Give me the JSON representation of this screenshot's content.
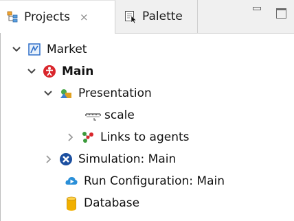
{
  "tabs": {
    "projects": {
      "label": "Projects",
      "close_glyph": "⨯",
      "icon": "projects-icon"
    },
    "palette": {
      "label": "Palette",
      "icon": "palette-icon"
    }
  },
  "view_controls": {
    "minimize_icon": "minimize-icon",
    "maximize_icon": "maximize-icon"
  },
  "tree": {
    "market": {
      "label": "Market",
      "icon": "model-icon",
      "expanded": true
    },
    "main": {
      "label": "Main",
      "icon": "agent-icon",
      "expanded": true,
      "bold": true
    },
    "presentation": {
      "label": "Presentation",
      "icon": "presentation-icon",
      "expanded": true
    },
    "scale": {
      "label": "scale",
      "icon": "scale-icon"
    },
    "links": {
      "label": "Links to agents",
      "icon": "links-icon",
      "expanded": false
    },
    "simulation": {
      "label": "Simulation: Main",
      "icon": "simulation-icon",
      "expanded": false
    },
    "run_config": {
      "label": "Run Configuration: Main",
      "icon": "run-config-icon"
    },
    "database": {
      "label": "Database",
      "icon": "database-icon"
    }
  },
  "colors": {
    "agent_red": "#d9262c",
    "simulation_blue": "#1b4fa0",
    "run_blue": "#2a8fd8",
    "database_yellow": "#f1b000",
    "model_blue": "#2f6fc9"
  }
}
